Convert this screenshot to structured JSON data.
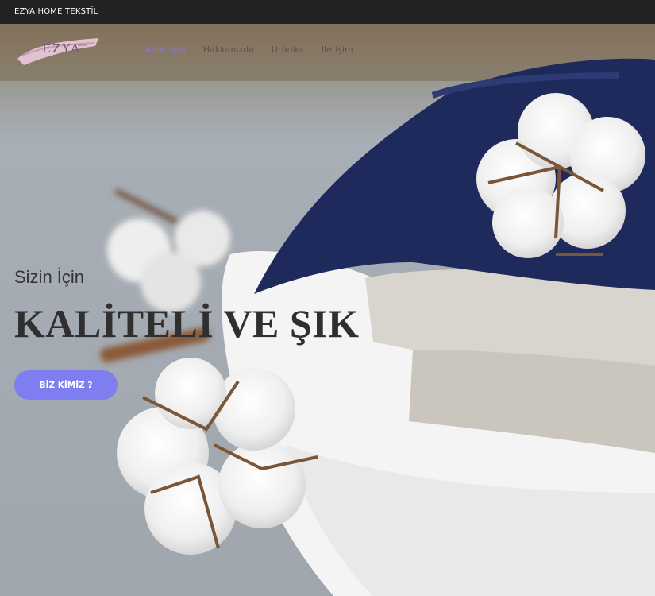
{
  "topbar": {
    "text": "EZYA HOME TEKSTİL"
  },
  "logo": {
    "text": "EZYA",
    "small": "HOME",
    "brush_color": "#e2c2d0"
  },
  "nav": {
    "items": [
      {
        "label": "Anasayfa",
        "active": true
      },
      {
        "label": "Hakkımızda",
        "active": false
      },
      {
        "label": "Ürünler",
        "active": false
      },
      {
        "label": "İletişim",
        "active": false
      }
    ]
  },
  "hero": {
    "subtitle": "Sizin İçin",
    "title": "KALİTELİ VE ŞIK",
    "cta_label": "BİZ KİMİZ ?"
  },
  "colors": {
    "accent": "#7f7ef0",
    "topbar": "#222222",
    "navy": "#1f2a5c"
  }
}
